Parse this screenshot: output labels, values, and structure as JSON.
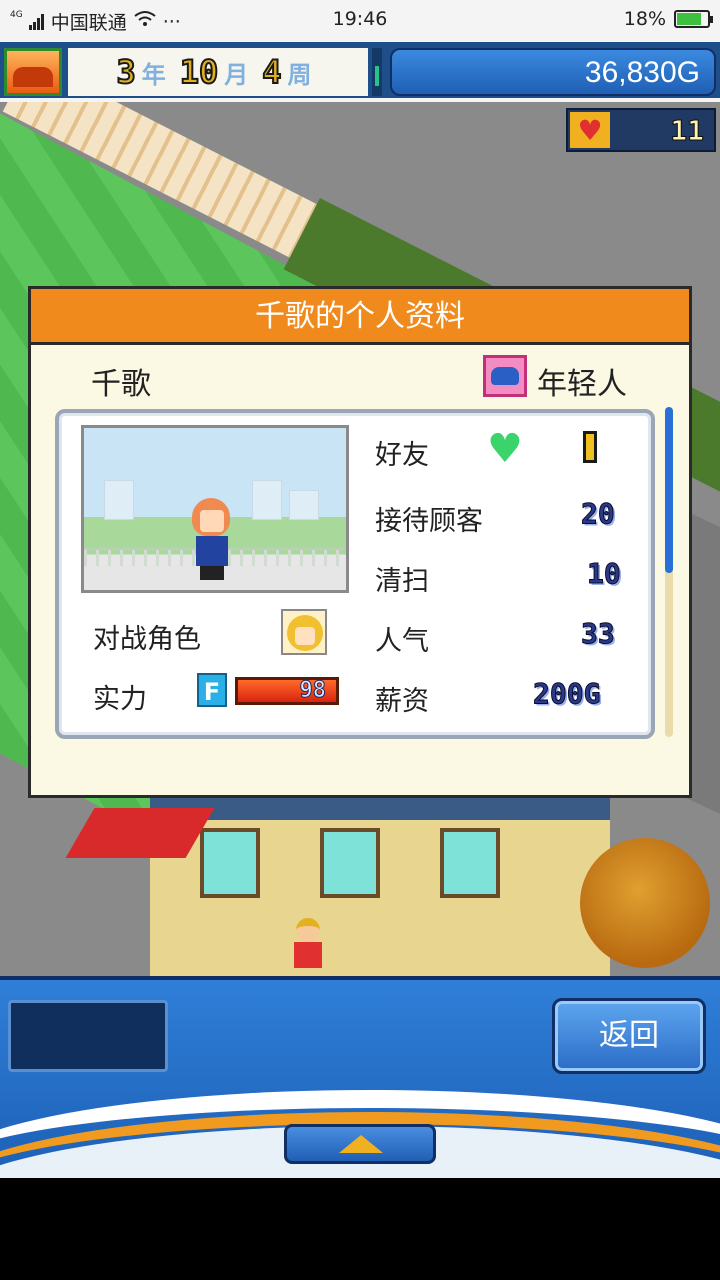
{
  "statusbar": {
    "net": "4G",
    "carrier": "中国联通",
    "more": "···",
    "time": "19:46",
    "battery": "18%"
  },
  "hud": {
    "year_num": "3",
    "year_unit": "年",
    "month_num": "10",
    "month_unit": "月",
    "week_num": "4",
    "week_unit": "周",
    "money": "36,830G",
    "hearts": "11"
  },
  "dialog": {
    "title": "千歌的个人资料",
    "name": "千歌",
    "age_group": "年轻人",
    "stats": {
      "friend_label": "好友",
      "friend_value": 1,
      "reception_label": "接待顾客",
      "reception_value": "20",
      "cleaning_label": "清扫",
      "cleaning_value": "10",
      "popularity_label": "人气",
      "popularity_value": "33",
      "salary_label": "薪资",
      "salary_value": "200G",
      "rival_label": "对战角色",
      "power_label": "实力",
      "power_rank": "F",
      "power_value": "98"
    }
  },
  "bottom": {
    "back_label": "返回"
  },
  "icons": {
    "heart": "heart-icon",
    "friend": "green-heart-icon",
    "age": "car-icon",
    "season": "autumn-icon",
    "up": "up-arrow-icon"
  },
  "colors": {
    "title_bar": "#f08a1c",
    "hud_blue": "#1e4f8a",
    "dialog_bg": "#fbf8e3"
  }
}
